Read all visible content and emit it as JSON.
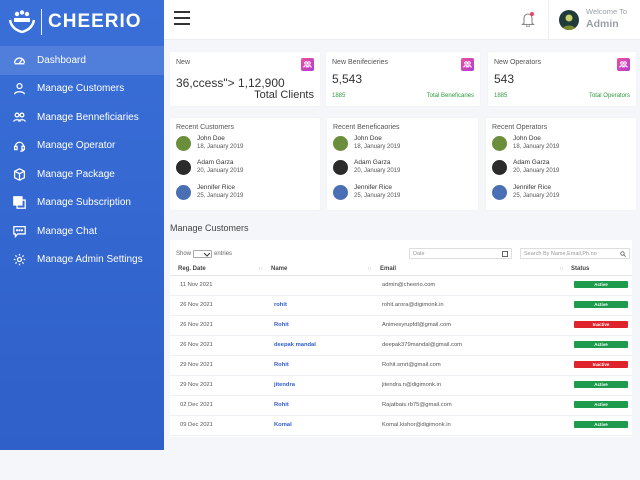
{
  "brand": {
    "name": "CHEERIO"
  },
  "sidebar": {
    "items": [
      {
        "label": "Dashboard",
        "icon": "dashboard-icon",
        "active": true
      },
      {
        "label": "Manage Customers",
        "icon": "user-icon"
      },
      {
        "label": "Manage Benneficiaries",
        "icon": "users-icon"
      },
      {
        "label": "Manage Operator",
        "icon": "headset-icon"
      },
      {
        "label": "Manage Package",
        "icon": "box-icon"
      },
      {
        "label": "Manage Subscription",
        "icon": "copy-icon"
      },
      {
        "label": "Manage Chat",
        "icon": "chat-icon"
      },
      {
        "label": "Manage Admin Settings",
        "icon": "gear-icon"
      }
    ]
  },
  "header": {
    "welcome": "Welcome To",
    "user": "Admin"
  },
  "stats": [
    {
      "title": "New",
      "value": "36,ccess\">  1,12,900",
      "label": "Total Clients"
    },
    {
      "title": "New Benifecieries",
      "value": "5,543",
      "small": "1885",
      "label": "Total Beneficaries"
    },
    {
      "title": "New Operators",
      "value": "543",
      "small": "1885",
      "label": "Total Operators"
    }
  ],
  "recent": [
    {
      "title": "Recent Customers",
      "people": [
        {
          "name": "John Doe",
          "date": "18, January 2019"
        },
        {
          "name": "Adam Garza",
          "date": "20, January 2019"
        },
        {
          "name": "Jennifer Rice",
          "date": "25, January 2019"
        }
      ]
    },
    {
      "title": "Recent Beneficaories",
      "people": [
        {
          "name": "John Doe",
          "date": "18, January 2019"
        },
        {
          "name": "Adam Garza",
          "date": "20, January 2019"
        },
        {
          "name": "Jennifer Rice",
          "date": "25, January 2019"
        }
      ]
    },
    {
      "title": "Recent Operators",
      "people": [
        {
          "name": "John Doe",
          "date": "18, January 2019"
        },
        {
          "name": "Adam Garza",
          "date": "20, January 2019"
        },
        {
          "name": "Jennifer Rice",
          "date": "25, January 2019"
        }
      ]
    }
  ],
  "table": {
    "title": "Manage Customers",
    "show_prefix": "Show",
    "show_suffix": "entries",
    "date_placeholder": "Date",
    "search_placeholder": "Search By Name,Email,Ph.no",
    "columns": [
      "Reg. Date",
      "Name",
      "Email",
      "Status"
    ],
    "rows": [
      {
        "date": "11 Nov 2021",
        "name": "",
        "email": "admin@cheerio.com",
        "status": "Active"
      },
      {
        "date": "26 Nov 2021",
        "name": "rohit",
        "email": "rohit.arora@digimonk.in",
        "status": "Active"
      },
      {
        "date": "26 Nov 2021",
        "name": "Rohit",
        "email": "Animesyrupfdl@gmail.com",
        "status": "Inactive"
      },
      {
        "date": "26 Nov 2021",
        "name": "deepak mandal",
        "email": "deepak379mandal@gmail.com",
        "status": "Active"
      },
      {
        "date": "29 Nov 2021",
        "name": "Rohit",
        "email": "Rohit.smrt@gmail.com",
        "status": "Inactive"
      },
      {
        "date": "29 Nov 2021",
        "name": "jitendra",
        "email": "jitendra.n@digimonk.in",
        "status": "Active"
      },
      {
        "date": "02 Dec 2021",
        "name": "Rohit",
        "email": "Rajatbais.rb75@gmail.com",
        "status": "Active"
      },
      {
        "date": "09 Dec 2021",
        "name": "Komal",
        "email": "Komal.kishor@digimonk.in",
        "status": "Active"
      }
    ]
  },
  "colors": {
    "sidebar": "#3a6fd8",
    "active": "#1e9b4c",
    "inactive": "#e0242e",
    "accent": "#2f5fc9"
  }
}
